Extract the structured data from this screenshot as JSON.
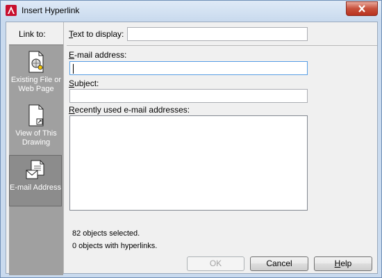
{
  "window": {
    "title": "Insert Hyperlink"
  },
  "left_panel": {
    "label": "Link to:",
    "items": [
      {
        "label": "Existing File or Web Page",
        "icon": "file-web-icon",
        "selected": false
      },
      {
        "label": "View of This Drawing",
        "icon": "drawing-view-icon",
        "selected": false
      },
      {
        "label": "E-mail Address",
        "icon": "email-address-icon",
        "selected": true
      }
    ]
  },
  "form": {
    "text_to_display_label": "Text to display:",
    "text_to_display_value": "",
    "email_label": "E-mail address:",
    "email_value": "",
    "subject_label": "Subject:",
    "subject_value": "",
    "recent_label": "Recently used e-mail addresses:",
    "recent_items": []
  },
  "status": {
    "selected": "82 objects selected.",
    "hyperlinks": "0 objects with hyperlinks."
  },
  "buttons": {
    "ok": "OK",
    "cancel": "Cancel",
    "help": "Help"
  }
}
